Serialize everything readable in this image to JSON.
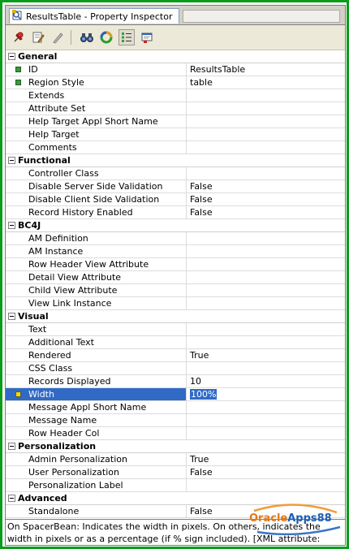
{
  "tab": {
    "title": "ResultsTable - Property Inspector"
  },
  "toolbar": {
    "icons": [
      "pushpin-icon",
      "edit-icon",
      "pencil-icon",
      "binoculars-icon",
      "refresh-icon",
      "categorized-view-icon",
      "help-icon"
    ]
  },
  "categories": [
    {
      "label": "General",
      "properties": [
        {
          "name": "ID",
          "value": "ResultsTable",
          "required": true
        },
        {
          "name": "Region Style",
          "value": "table",
          "required": true
        },
        {
          "name": "Extends",
          "value": ""
        },
        {
          "name": "Attribute Set",
          "value": ""
        },
        {
          "name": "Help Target Appl Short Name",
          "value": ""
        },
        {
          "name": "Help Target",
          "value": ""
        },
        {
          "name": "Comments",
          "value": ""
        }
      ]
    },
    {
      "label": "Functional",
      "properties": [
        {
          "name": "Controller Class",
          "value": ""
        },
        {
          "name": "Disable Server Side Validation",
          "value": "False"
        },
        {
          "name": "Disable Client Side Validation",
          "value": "False"
        },
        {
          "name": "Record History Enabled",
          "value": "False"
        }
      ]
    },
    {
      "label": "BC4J",
      "properties": [
        {
          "name": "AM Definition",
          "value": ""
        },
        {
          "name": "AM Instance",
          "value": ""
        },
        {
          "name": "Row Header View Attribute",
          "value": ""
        },
        {
          "name": "Detail View Attribute",
          "value": ""
        },
        {
          "name": "Child View Attribute",
          "value": ""
        },
        {
          "name": "View Link Instance",
          "value": ""
        }
      ]
    },
    {
      "label": "Visual",
      "properties": [
        {
          "name": "Text",
          "value": ""
        },
        {
          "name": "Additional Text",
          "value": ""
        },
        {
          "name": "Rendered",
          "value": "True"
        },
        {
          "name": "CSS Class",
          "value": ""
        },
        {
          "name": "Records Displayed",
          "value": "10"
        },
        {
          "name": "Width",
          "value": "100%",
          "required": true,
          "selected": true
        },
        {
          "name": "Message Appl Short Name",
          "value": ""
        },
        {
          "name": "Message Name",
          "value": ""
        },
        {
          "name": "Row Header Col",
          "value": ""
        }
      ]
    },
    {
      "label": "Personalization",
      "properties": [
        {
          "name": "Admin Personalization",
          "value": "True"
        },
        {
          "name": "User Personalization",
          "value": "False"
        },
        {
          "name": "Personalization Label",
          "value": ""
        }
      ]
    },
    {
      "label": "Advanced",
      "properties": [
        {
          "name": "Standalone",
          "value": "False"
        }
      ]
    }
  ],
  "description": "On SpacerBean: Indicates the width in pixels. On others, indicates the width in pixels or as a percentage (if % sign included). [XML attribute: width]",
  "watermark": {
    "prefix": "Oracle",
    "suffix": "Apps88"
  }
}
